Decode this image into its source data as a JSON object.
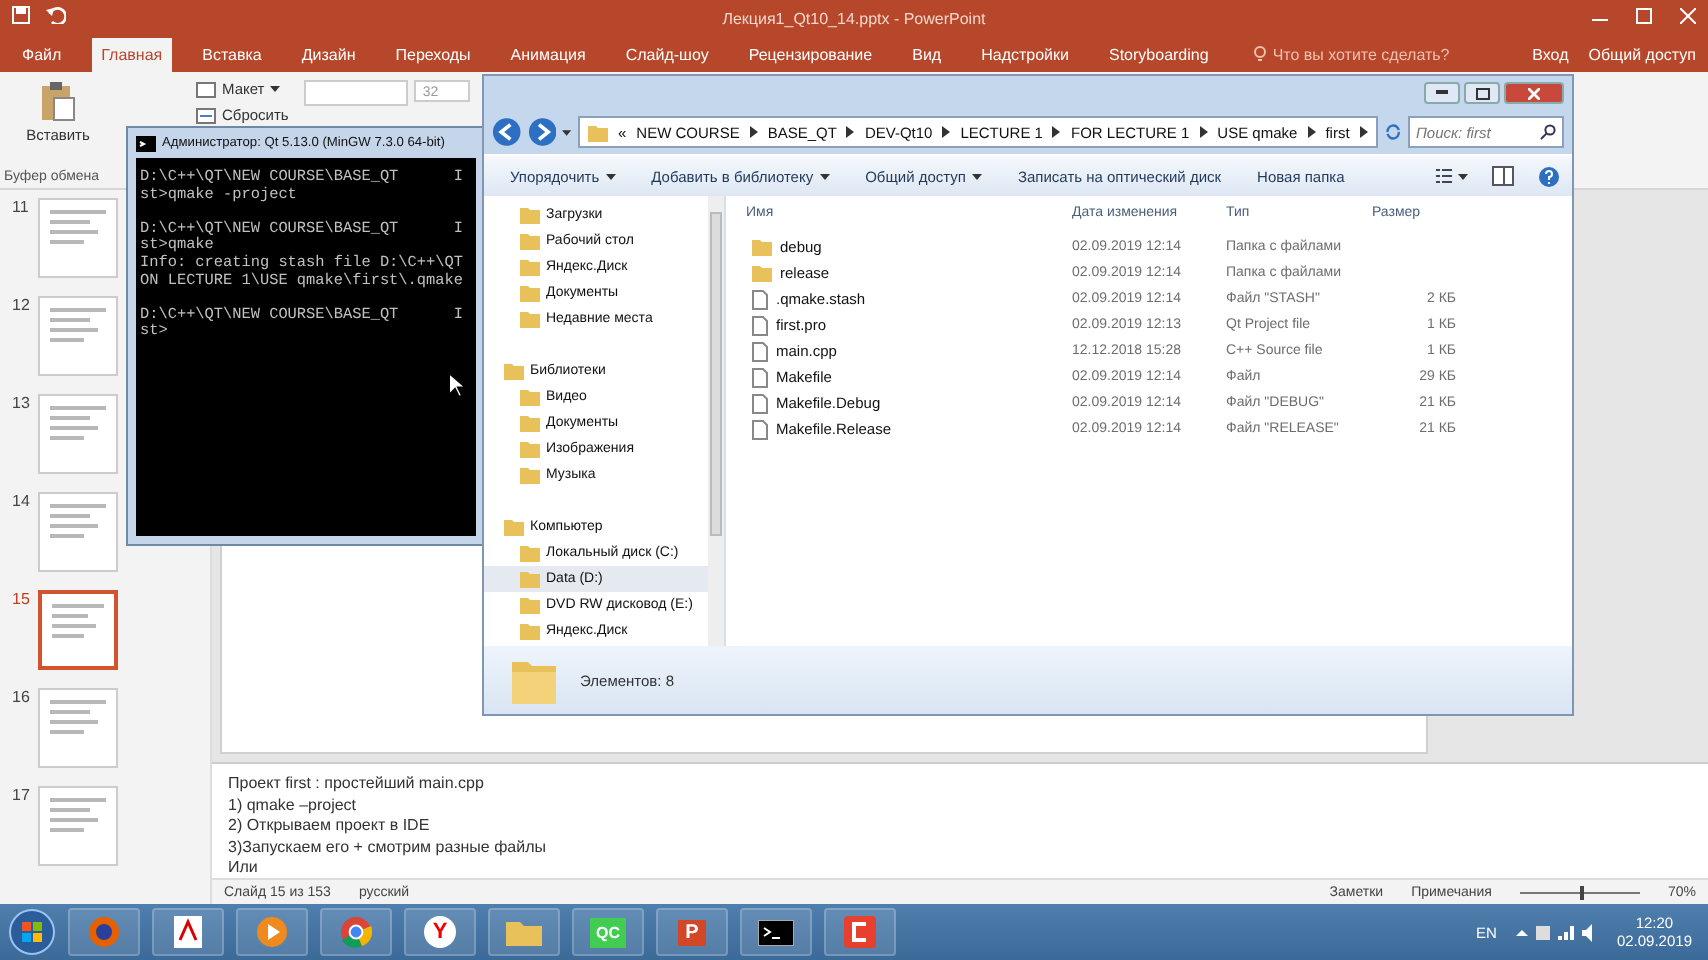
{
  "ppt": {
    "title": "Лекция1_Qt10_14.pptx - PowerPoint",
    "tabs": [
      {
        "label": "Файл",
        "selected": false
      },
      {
        "label": "Главная",
        "selected": true
      },
      {
        "label": "Вставка",
        "selected": false
      },
      {
        "label": "Дизайн",
        "selected": false
      },
      {
        "label": "Переходы",
        "selected": false
      },
      {
        "label": "Анимация",
        "selected": false
      },
      {
        "label": "Слайд-шоу",
        "selected": false
      },
      {
        "label": "Рецензирование",
        "selected": false
      },
      {
        "label": "Вид",
        "selected": false
      },
      {
        "label": "Надстройки",
        "selected": false
      },
      {
        "label": "Storyboarding",
        "selected": false
      }
    ],
    "search_placeholder": "Что вы хотите сделать?",
    "sign_in": "Вход",
    "share": "Общий доступ",
    "ribbon": {
      "paste": "Вставить",
      "layout": "Макет",
      "reset": "Сбросить",
      "font_size": "32",
      "group_label": "Буфер обмена"
    },
    "slides": [
      {
        "number": "11",
        "selected": false
      },
      {
        "number": "12",
        "selected": false
      },
      {
        "number": "13",
        "selected": false
      },
      {
        "number": "14",
        "selected": false
      },
      {
        "number": "15",
        "selected": true
      },
      {
        "number": "16",
        "selected": false
      },
      {
        "number": "17",
        "selected": false
      }
    ],
    "notes": [
      "Проект  first :  простейший main.cpp",
      "1) qmake –project",
      "2) Открываем проект в IDE",
      "3)Запускаем его + смотрим разные файлы",
      "Или"
    ],
    "status_bar": {
      "slide": "Слайд 15 из 153",
      "language": "русский",
      "notes": "Заметки",
      "comments": "Примечания",
      "zoom": "70%",
      "zoom_level": {
        "level": 0.5
      }
    }
  },
  "cmd": {
    "title": "Администратор: Qt 5.13.0 (MinGW 7.3.0 64-bit)",
    "blocks": [
      [
        "D:\\C++\\QT\\NEW COURSE\\BASE_QT      I",
        "st>qmake -project"
      ],
      [
        "D:\\C++\\QT\\NEW COURSE\\BASE_QT      I",
        "st>qmake",
        "Info: creating stash file D:\\C++\\QT",
        "ON LECTURE 1\\USE qmake\\first\\.qmake"
      ],
      [
        "D:\\C++\\QT\\NEW COURSE\\BASE_QT      I",
        "st>"
      ]
    ]
  },
  "explorer": {
    "path": [
      "«",
      "NEW COURSE",
      "BASE_QT",
      "DEV-Qt10",
      "LECTURE 1",
      "FOR LECTURE 1",
      "USE qmake",
      "first"
    ],
    "search_placeholder": "Поиск: first",
    "toolbar": [
      "Упорядочить",
      "Добавить в библиотеку",
      "Общий доступ",
      "Записать на оптический диск",
      "Новая папка"
    ],
    "favorites": [
      {
        "label": "Загрузки",
        "selected": false
      },
      {
        "label": "Рабочий стол",
        "selected": false
      },
      {
        "label": "Яндекс.Диск",
        "selected": false
      },
      {
        "label": "Документы",
        "selected": false
      },
      {
        "label": "Недавние места",
        "selected": false
      }
    ],
    "groups": [
      {
        "label": "Библиотеки",
        "selected": false,
        "children": [
          {
            "label": "Видео",
            "selected": false
          },
          {
            "label": "Документы",
            "selected": false
          },
          {
            "label": "Изображения",
            "selected": false
          },
          {
            "label": "Музыка",
            "selected": false
          }
        ]
      },
      {
        "label": "Компьютер",
        "selected": false,
        "children": [
          {
            "label": "Локальный диск (C:)",
            "selected": false
          },
          {
            "label": "Data (D:)",
            "selected": true
          },
          {
            "label": "DVD RW дисковод (E:)",
            "selected": false
          },
          {
            "label": "Яндекс.Диск",
            "selected": false
          }
        ]
      }
    ],
    "columns": [
      "Имя",
      "Дата изменения",
      "Тип",
      "Размер"
    ],
    "files": [
      {
        "kind": "folder",
        "name": "debug",
        "date": "02.09.2019 12:14",
        "type": "Папка с файлами"
      },
      {
        "kind": "folder",
        "name": "release",
        "date": "02.09.2019 12:14",
        "type": "Папка с файлами"
      },
      {
        "kind": "file",
        "name": ".qmake.stash",
        "date": "02.09.2019 12:14",
        "type": "Файл \"STASH\"",
        "size": "2 КБ"
      },
      {
        "kind": "file",
        "name": "first.pro",
        "date": "02.09.2019 12:13",
        "type": "Qt Project file",
        "size": "1 КБ"
      },
      {
        "kind": "file",
        "name": "main.cpp",
        "date": "12.12.2018 15:28",
        "type": "C++ Source file",
        "size": "1 КБ"
      },
      {
        "kind": "file",
        "name": "Makefile",
        "date": "02.09.2019 12:14",
        "type": "Файл",
        "size": "29 КБ"
      },
      {
        "kind": "file",
        "name": "Makefile.Debug",
        "date": "02.09.2019 12:14",
        "type": "Файл \"DEBUG\"",
        "size": "21 КБ"
      },
      {
        "kind": "file",
        "name": "Makefile.Release",
        "date": "02.09.2019 12:14",
        "type": "Файл \"RELEASE\"",
        "size": "21 КБ"
      }
    ],
    "status": "Элементов: 8"
  },
  "taskbar": {
    "apps": [
      {
        "kind": "firefox"
      },
      {
        "kind": "pdf"
      },
      {
        "kind": "player"
      },
      {
        "kind": "chrome"
      },
      {
        "kind": "yandex",
        "label": "Y"
      },
      {
        "kind": "folder"
      },
      {
        "kind": "qc",
        "label": "QC"
      },
      {
        "kind": "ppt",
        "label": "P"
      },
      {
        "kind": "cmd"
      },
      {
        "kind": "red"
      }
    ],
    "language": "EN",
    "time": "12:20",
    "date": "02.09.2019"
  }
}
